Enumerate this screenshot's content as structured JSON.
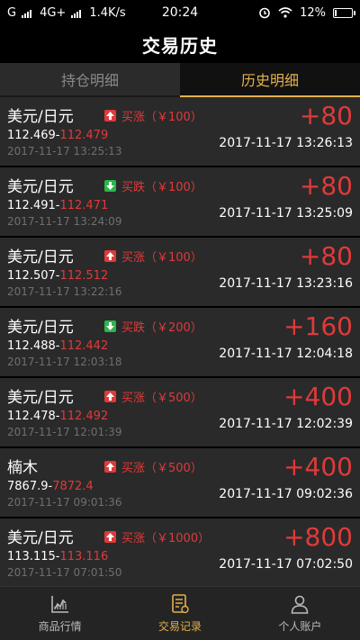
{
  "status_bar": {
    "carrier": "G",
    "network": "4G+",
    "speed": "1.4K/s",
    "time": "20:24",
    "battery": "12%",
    "battery_level": 0.12,
    "icons": [
      "signal-icon",
      "alarm-icon",
      "wifi-icon",
      "battery-icon"
    ]
  },
  "nav": {
    "title": "交易历史"
  },
  "tabs": [
    {
      "label": "持仓明细",
      "active": false
    },
    {
      "label": "历史明细",
      "active": true
    }
  ],
  "trades": [
    {
      "name": "美元/日元",
      "direction": "up",
      "tag": "买涨（￥100）",
      "open_price": "112.469",
      "close_price": "112.479",
      "open_time": "2017-11-17 13:25:13",
      "profit": "+80",
      "close_time": "2017-11-17 13:26:13"
    },
    {
      "name": "美元/日元",
      "direction": "down",
      "tag": "买跌（￥100）",
      "open_price": "112.491",
      "close_price": "112.471",
      "open_time": "2017-11-17 13:24:09",
      "profit": "+80",
      "close_time": "2017-11-17 13:25:09"
    },
    {
      "name": "美元/日元",
      "direction": "up",
      "tag": "买涨（￥100）",
      "open_price": "112.507",
      "close_price": "112.512",
      "open_time": "2017-11-17 13:22:16",
      "profit": "+80",
      "close_time": "2017-11-17 13:23:16"
    },
    {
      "name": "美元/日元",
      "direction": "down",
      "tag": "买跌（￥200）",
      "open_price": "112.488",
      "close_price": "112.442",
      "open_time": "2017-11-17 12:03:18",
      "profit": "+160",
      "close_time": "2017-11-17 12:04:18"
    },
    {
      "name": "美元/日元",
      "direction": "up",
      "tag": "买涨（￥500）",
      "open_price": "112.478",
      "close_price": "112.492",
      "open_time": "2017-11-17 12:01:39",
      "profit": "+400",
      "close_time": "2017-11-17 12:02:39"
    },
    {
      "name": "楠木",
      "direction": "up",
      "tag": "买涨（￥500）",
      "open_price": "7867.9",
      "close_price": "7872.4",
      "open_time": "2017-11-17 09:01:36",
      "profit": "+400",
      "close_time": "2017-11-17 09:02:36"
    },
    {
      "name": "美元/日元",
      "direction": "up",
      "tag": "买涨（￥1000）",
      "open_price": "113.115",
      "close_price": "113.116",
      "open_time": "2017-11-17 07:01:50",
      "profit": "+800",
      "close_time": "2017-11-17 07:02:50"
    }
  ],
  "bottom_nav": [
    {
      "label": "商品行情",
      "icon": "chart-icon",
      "active": false
    },
    {
      "label": "交易记录",
      "icon": "record-icon",
      "active": true
    },
    {
      "label": "个人账户",
      "icon": "person-icon",
      "active": false
    }
  ],
  "colors": {
    "accent": "#e4b04a",
    "profit_red": "#e03a3a",
    "down_green": "#2bb54a",
    "row_bg": "#2a2a2a"
  }
}
